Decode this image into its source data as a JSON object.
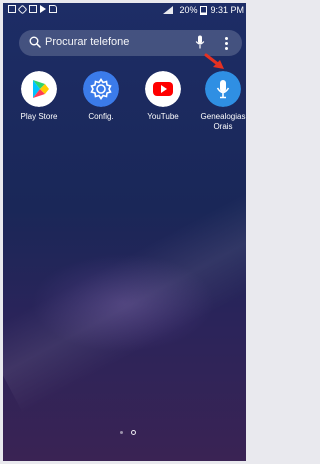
{
  "status_bar": {
    "left_icons": [
      "gallery-icon",
      "tools-icon",
      "clipboard-icon",
      "play-icon",
      "sd-card-icon"
    ],
    "battery": "20%",
    "time": "9:31 PM"
  },
  "search": {
    "placeholder": "Procurar telefone"
  },
  "apps": [
    {
      "label": "Play Store",
      "icon": "play-store-icon",
      "color": "#ffffff"
    },
    {
      "label": "Config.",
      "icon": "settings-gear-icon",
      "color": "#3b7bea"
    },
    {
      "label": "YouTube",
      "icon": "youtube-icon",
      "color": "#ffffff"
    },
    {
      "label": "Genealogias Orais",
      "icon": "microphone-icon",
      "color": "#2f8fe3"
    }
  ],
  "annotation": {
    "arrow_color": "#e53122"
  },
  "pager": {
    "indicators": [
      "home",
      "page"
    ]
  }
}
